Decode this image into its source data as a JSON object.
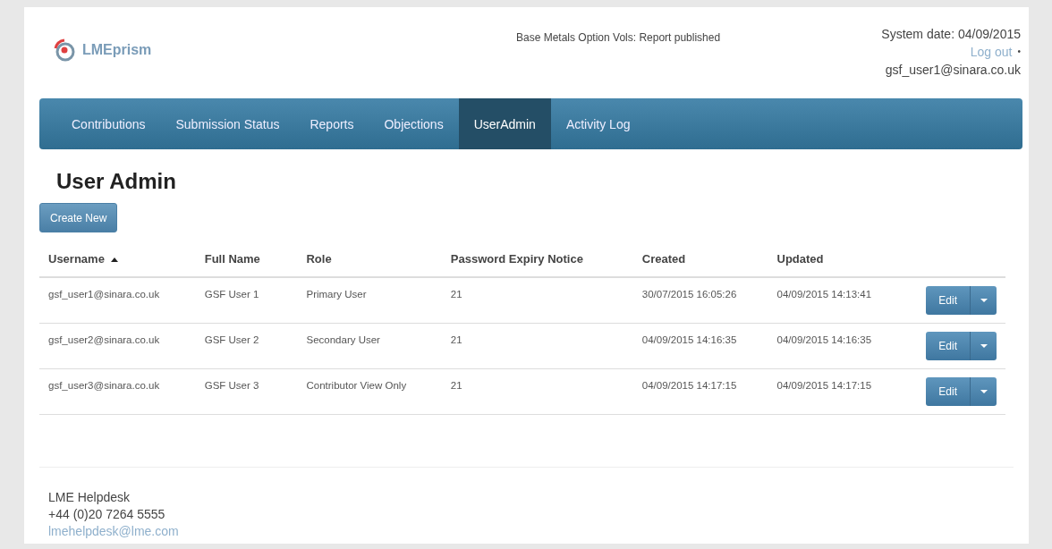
{
  "header": {
    "logo": "LMEprism",
    "notice": "Base Metals Option Vols: Report published",
    "system_date": "System date: 04/09/2015",
    "logout": "Log out",
    "bullet": "•",
    "user": "gsf_user1@sinara.co.uk"
  },
  "nav": [
    {
      "label": "Contributions",
      "selected": false
    },
    {
      "label": "Submission Status",
      "selected": false
    },
    {
      "label": "Reports",
      "selected": false
    },
    {
      "label": "Objections",
      "selected": false
    },
    {
      "label": "UserAdmin",
      "selected": true
    },
    {
      "label": "Activity Log",
      "selected": false
    }
  ],
  "page_title": "User Admin",
  "create_button": "Create New",
  "table": {
    "columns": [
      {
        "label": "Username",
        "sorted": true
      },
      {
        "label": "Full Name",
        "sorted": false
      },
      {
        "label": "Role",
        "sorted": false
      },
      {
        "label": "Password Expiry Notice",
        "sorted": false
      },
      {
        "label": "Created",
        "sorted": false
      },
      {
        "label": "Updated",
        "sorted": false
      }
    ],
    "rows": [
      {
        "cells": [
          "gsf_user1@sinara.co.uk",
          "GSF User 1",
          "Primary User",
          "21",
          "30/07/2015 16:05:26",
          "04/09/2015 14:13:41"
        ],
        "action": "Edit"
      },
      {
        "cells": [
          "gsf_user2@sinara.co.uk",
          "GSF User 2",
          "Secondary User",
          "21",
          "04/09/2015 14:16:35",
          "04/09/2015 14:16:35"
        ],
        "action": "Edit"
      },
      {
        "cells": [
          "gsf_user3@sinara.co.uk",
          "GSF User 3",
          "Contributor View Only",
          "21",
          "04/09/2015 14:17:15",
          "04/09/2015 14:17:15"
        ],
        "action": "Edit"
      }
    ]
  },
  "footer": {
    "name": "LME Helpdesk",
    "phone": "+44 (0)20 7264 5555",
    "email": "lmehelpdesk@lme.com"
  }
}
